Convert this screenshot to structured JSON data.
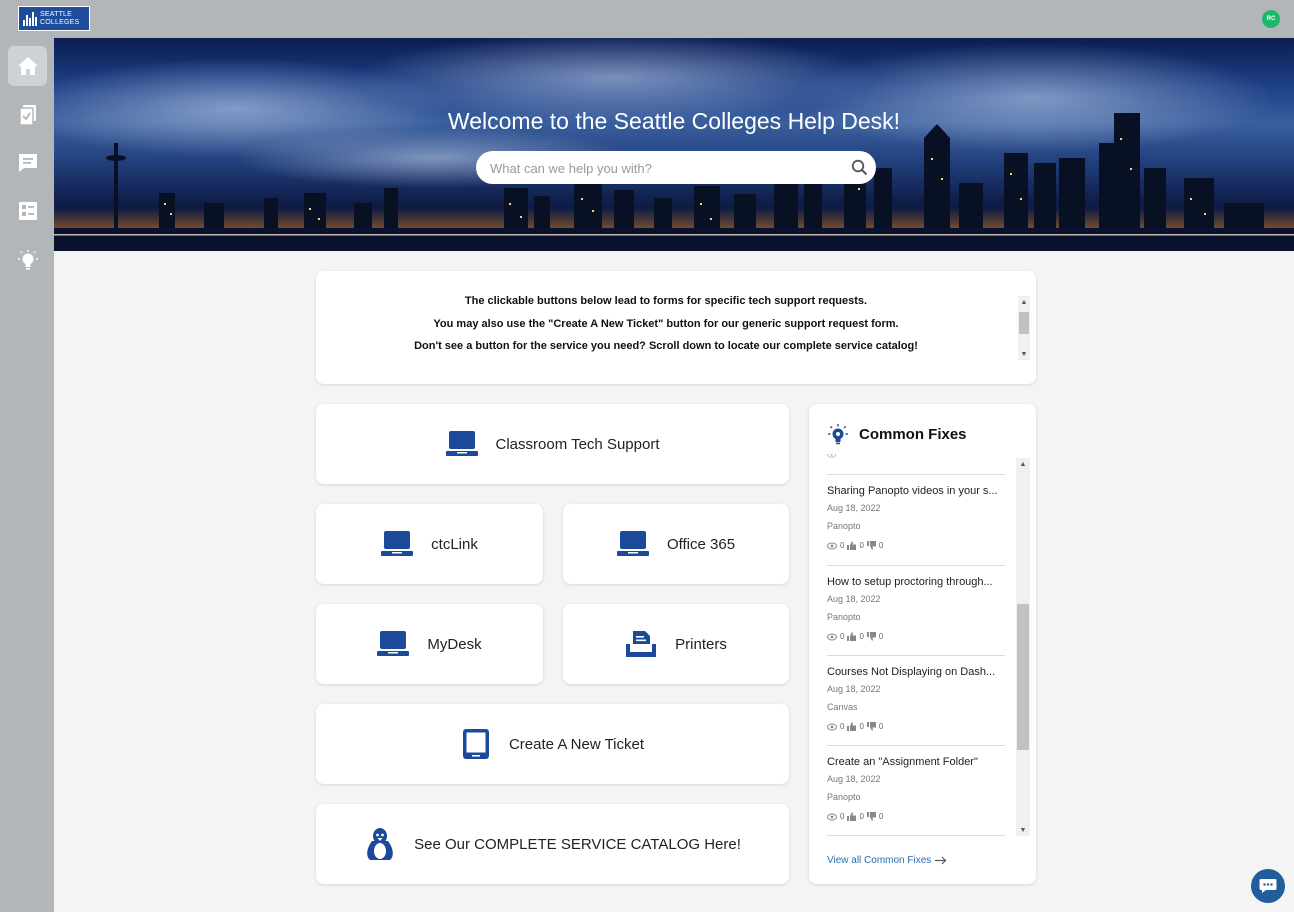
{
  "brand": {
    "logo_line1": "SEATTLE",
    "logo_line2": "COLLEGES"
  },
  "user": {
    "initials": "RC"
  },
  "hero": {
    "title": "Welcome to the Seattle Colleges Help Desk!",
    "search_placeholder": "What can we help you with?"
  },
  "notice": {
    "line1": "The clickable buttons below lead to forms for specific tech support requests.",
    "line2": "You may also use the \"Create A New Ticket\" button for our generic support request form.",
    "line3": "Don't see a button for the service you need?  Scroll down to locate our complete service catalog!"
  },
  "tiles": {
    "classroom": "Classroom Tech Support",
    "ctclink": "ctcLink",
    "office365": "Office 365",
    "mydesk": "MyDesk",
    "printers": "Printers",
    "new_ticket": "Create A New Ticket",
    "catalog": "See Our COMPLETE SERVICE CATALOG Here!"
  },
  "common_fixes": {
    "title": "Common Fixes",
    "view_all": "View all Common Fixes",
    "items": [
      {
        "title": "Sharing Panopto videos in your s...",
        "date": "Aug 18, 2022",
        "category": "Panopto",
        "views": "0",
        "likes": "0",
        "dislikes": "0"
      },
      {
        "title": "How to setup proctoring through...",
        "date": "Aug 18, 2022",
        "category": "Panopto",
        "views": "0",
        "likes": "0",
        "dislikes": "0"
      },
      {
        "title": "Courses Not Displaying on Dash...",
        "date": "Aug 18, 2022",
        "category": "Canvas",
        "views": "0",
        "likes": "0",
        "dislikes": "0"
      },
      {
        "title": "Create an \"Assignment Folder\"",
        "date": "Aug 18, 2022",
        "category": "Panopto",
        "views": "0",
        "likes": "0",
        "dislikes": "0"
      }
    ]
  },
  "colors": {
    "brand_blue": "#1d4c9c",
    "icon_blue": "#1c4a9a",
    "avatar_green": "#1fb86b",
    "chrome_gray": "#b3b6b9"
  }
}
